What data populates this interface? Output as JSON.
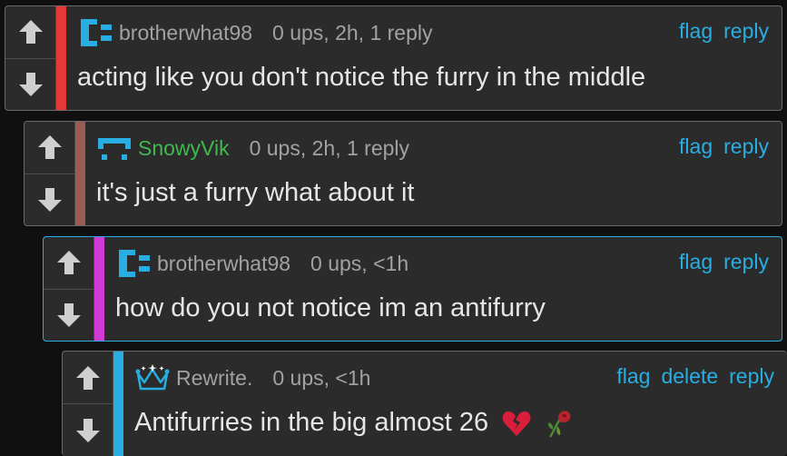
{
  "colors": {
    "accent": "#28aee3",
    "comment_bg": "#2b2b2b",
    "stripe_red": "#e53935",
    "stripe_brown": "#9c5a55",
    "stripe_magenta": "#d23ad6",
    "stripe_blue": "#28aee3",
    "username_green": "#3fb950"
  },
  "comments": [
    {
      "user": "brotherwhat98",
      "badge": "pixel-bracket-icon",
      "stats": "0 ups, 2h, 1 reply",
      "actions": [
        "flag",
        "reply"
      ],
      "text": "acting like you don't notice the furry in the middle"
    },
    {
      "user": "SnowyVik",
      "badge": "pixel-frame-icon",
      "stats": "0 ups, 2h, 1 reply",
      "actions": [
        "flag",
        "reply"
      ],
      "text": "it's just a furry what about it"
    },
    {
      "user": "brotherwhat98",
      "badge": "pixel-bracket-icon",
      "stats": "0 ups, <1h",
      "actions": [
        "flag",
        "reply"
      ],
      "text": "how do you not notice im an antifurry"
    },
    {
      "user": "Rewrite.",
      "badge": "crown-icon",
      "stats": "0 ups, <1h",
      "actions": [
        "flag",
        "delete",
        "reply"
      ],
      "text": "Antifurries in the big almost 26"
    }
  ]
}
